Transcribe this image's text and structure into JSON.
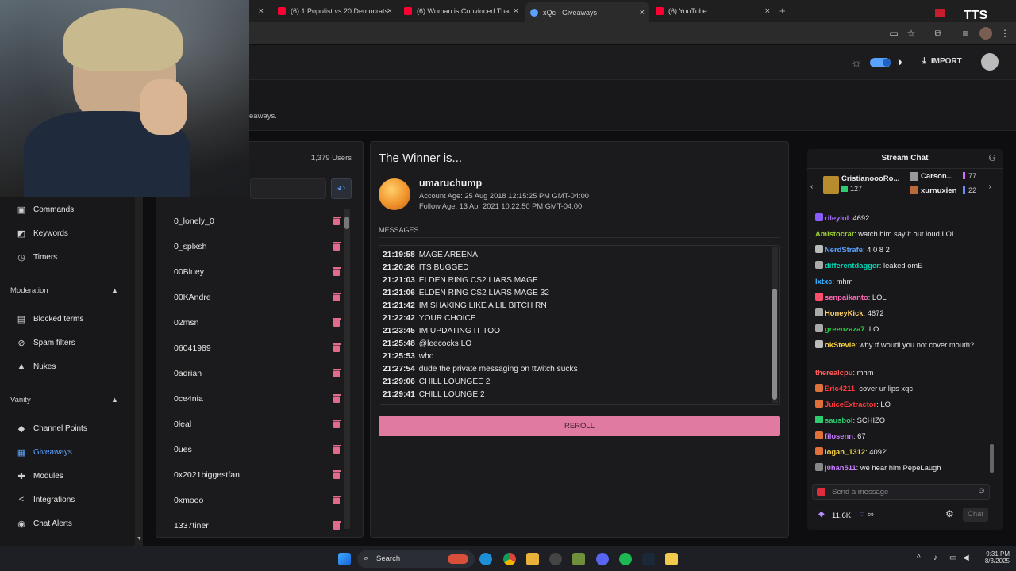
{
  "browser": {
    "tabs": [
      {
        "label": "(6) 1 Populist vs 20 Democrats",
        "favicon_color": "#ff0033"
      },
      {
        "label": "(6) Woman is Convinced That I...",
        "favicon_color": "#ff0033"
      },
      {
        "label": "xQc - Giveaways",
        "favicon_color": "#5aa2ff",
        "active": true
      },
      {
        "label": "(6) YouTube",
        "favicon_color": "#ff0033"
      }
    ],
    "new_tab": "+",
    "tts_label": "TTS"
  },
  "header": {
    "import_label": "IMPORT",
    "subtitle_fragment": "eaways."
  },
  "sidebar": {
    "items": [
      {
        "label": "Commands",
        "icon": "terminal-icon",
        "glyph": "▣"
      },
      {
        "label": "Keywords",
        "icon": "keywords-icon",
        "glyph": "◩"
      },
      {
        "label": "Timers",
        "icon": "clock-icon",
        "glyph": "◷"
      }
    ],
    "moderation": {
      "title": "Moderation",
      "items": [
        {
          "label": "Blocked terms",
          "icon": "blocked-icon",
          "glyph": "▤"
        },
        {
          "label": "Spam filters",
          "icon": "spam-icon",
          "glyph": "⊘"
        },
        {
          "label": "Nukes",
          "icon": "nuke-icon",
          "glyph": "▲"
        }
      ]
    },
    "vanity": {
      "title": "Vanity",
      "items": [
        {
          "label": "Channel Points",
          "icon": "channel-points-icon",
          "glyph": "◆"
        },
        {
          "label": "Giveaways",
          "icon": "giveaways-icon",
          "glyph": "▦",
          "active": true
        },
        {
          "label": "Modules",
          "icon": "modules-icon",
          "glyph": "✚"
        },
        {
          "label": "Integrations",
          "icon": "integrations-icon",
          "glyph": "<"
        },
        {
          "label": "Chat Alerts",
          "icon": "chat-alerts-icon",
          "glyph": "◉"
        }
      ]
    }
  },
  "users": {
    "count": "1,379 Users",
    "list": [
      "0_lonely_0",
      "0_splxsh",
      "00Bluey",
      "00KAndre",
      "02msn",
      "06041989",
      "0adrian",
      "0ce4nia",
      "0leal",
      "0ues",
      "0x2021biggestfan",
      "0xmooo",
      "1337tiner"
    ]
  },
  "winner": {
    "title": "The Winner is...",
    "username": "umaruchump",
    "account_age": "Account Age: 25 Aug 2018 12:15:25 PM GMT-04:00",
    "follow_age": "Follow Age: 13 Apr 2021 10:22:50 PM GMT-04:00",
    "messages_label": "MESSAGES",
    "messages": [
      {
        "time": "21:19:58",
        "text": "MAGE AREENA"
      },
      {
        "time": "21:20:26",
        "text": "ITS BUGGED"
      },
      {
        "time": "21:21:03",
        "text": "ELDEN RING CS2 LIARS MAGE"
      },
      {
        "time": "21:21:06",
        "text": "ELDEN RING CS2 LIARS MAGE 32"
      },
      {
        "time": "21:21:42",
        "text": "IM SHAKING LIKE A LIL BITCH RN"
      },
      {
        "time": "21:22:42",
        "text": "YOUR CHOICE"
      },
      {
        "time": "21:23:45",
        "text": "IM UPDATING IT TOO"
      },
      {
        "time": "21:25:48",
        "text": "@leecocks LO"
      },
      {
        "time": "21:25:53",
        "text": "who"
      },
      {
        "time": "21:27:54",
        "text": "dude the private messaging on ttwitch sucks"
      },
      {
        "time": "21:29:06",
        "text": "CHILL LOUNGEE 2"
      },
      {
        "time": "21:29:41",
        "text": "CHILL LOUNGE 2"
      }
    ],
    "reroll_label": "REROLL"
  },
  "chat": {
    "title": "Stream Chat",
    "gifters": [
      {
        "name": "CristianoooRo...",
        "count": "127"
      },
      {
        "name": "Carson...",
        "count": "77"
      },
      {
        "name": "xurnuxien",
        "count": "22"
      }
    ],
    "lines": [
      {
        "user": "rileylol",
        "color": "#a970ff",
        "sep": ": ",
        "text": "4692"
      },
      {
        "user": "Amistocrat",
        "color": "#9acd32",
        "sep": ": ",
        "text": "watch him say it out loud LOL"
      },
      {
        "user": "NerdStrafe",
        "color": "#5aa2ff",
        "sep": ": ",
        "text": "4 0 8 2"
      },
      {
        "user": "differentdagger",
        "color": "#00d6b4",
        "sep": ": ",
        "text": "leaked omE"
      },
      {
        "user": "lxtxc",
        "color": "#3bb3ff",
        "sep": ": ",
        "text": "mhm"
      },
      {
        "user": "senpaikanto",
        "color": "#ff69b4",
        "sep": ": ",
        "text": "LOL"
      },
      {
        "user": "HoneyKick",
        "color": "#ffd166",
        "sep": ": ",
        "text": "4672"
      },
      {
        "user": "greenzaza7",
        "color": "#2ecc40",
        "sep": ": ",
        "text": "LO"
      },
      {
        "user": "okStevie",
        "color": "#f5d142",
        "sep": ": ",
        "text": "why tf woudl you not cover mouth?"
      },
      {
        "user": "therealcpu",
        "color": "#ff5a5a",
        "sep": ": ",
        "text": "mhm"
      },
      {
        "user": "Eric4211",
        "color": "#ff3b3b",
        "sep": ": ",
        "text": "cover ur lips xqc"
      },
      {
        "user": "JuiceExtractor",
        "color": "#ff3b3b",
        "sep": ": ",
        "text": "LO"
      },
      {
        "user": "sausbol",
        "color": "#2ecc71",
        "sep": ": ",
        "text": "SCHIZO"
      },
      {
        "user": "filosenn",
        "color": "#c77dff",
        "sep": ": ",
        "text": "67"
      },
      {
        "user": "logan_1312",
        "color": "#f5d142",
        "sep": ": ",
        "text": "4092'"
      },
      {
        "user": "j0han511",
        "color": "#c77dff",
        "sep": ": ",
        "text": "we hear him PepeLaugh"
      }
    ],
    "input_placeholder": "Send a message",
    "points": "11.6K",
    "infinity": "∞",
    "chat_button": "Chat"
  },
  "taskbar": {
    "search_label": "Search",
    "time": "9:31 PM",
    "date": "8/3/2025"
  },
  "colors": {
    "accent": "#5aa2ff",
    "reroll": "#e07aa0",
    "trash": "#e06b8a"
  }
}
